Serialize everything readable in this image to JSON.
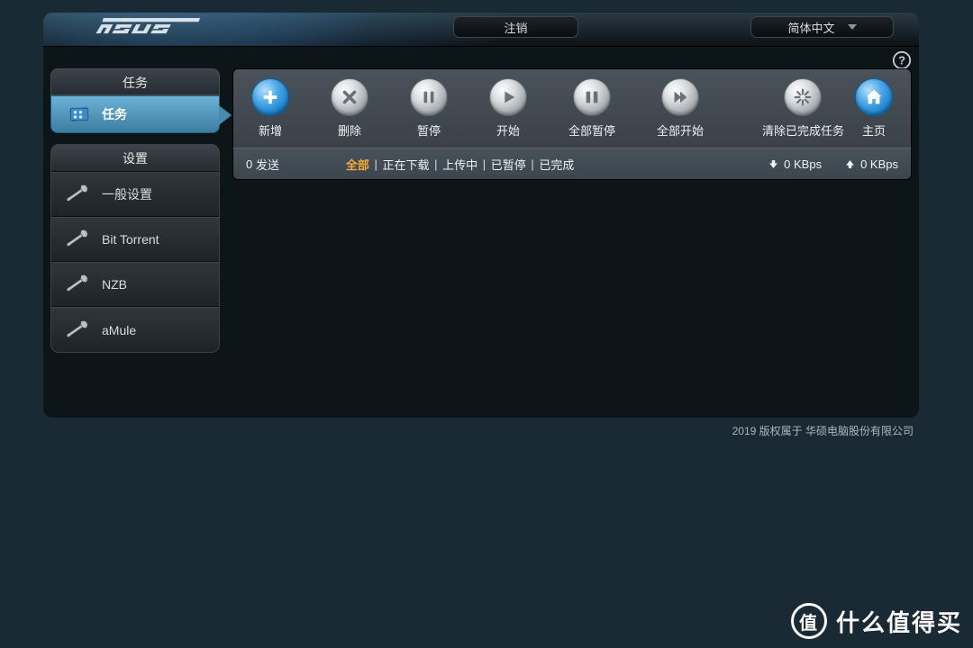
{
  "header": {
    "brand": "ASUS",
    "logout_label": "注销",
    "language_label": "简体中文"
  },
  "sidebar": {
    "section_tasks": "任务",
    "section_settings": "设置",
    "items": {
      "tasks": "任务",
      "general": "一般设置",
      "bt": "Bit Torrent",
      "nzb": "NZB",
      "amule": "aMule"
    }
  },
  "toolbar": {
    "add": "新增",
    "remove": "删除",
    "pause": "暂停",
    "start": "开始",
    "pause_all": "全部暂停",
    "start_all": "全部开始",
    "clear_done": "清除已完成任务",
    "home": "主页"
  },
  "filters": {
    "send_count": "0",
    "send_label": "发送",
    "all": "全部",
    "downloading": "正在下载",
    "uploading": "上传中",
    "paused": "已暂停",
    "finished": "已完成"
  },
  "rates": {
    "down": "0 KBps",
    "up": "0 KBps"
  },
  "footer": {
    "copyright": "2019 版权属于 华硕电脑股份有限公司"
  },
  "watermark": {
    "zhi": "值",
    "text": "什么值得买"
  }
}
